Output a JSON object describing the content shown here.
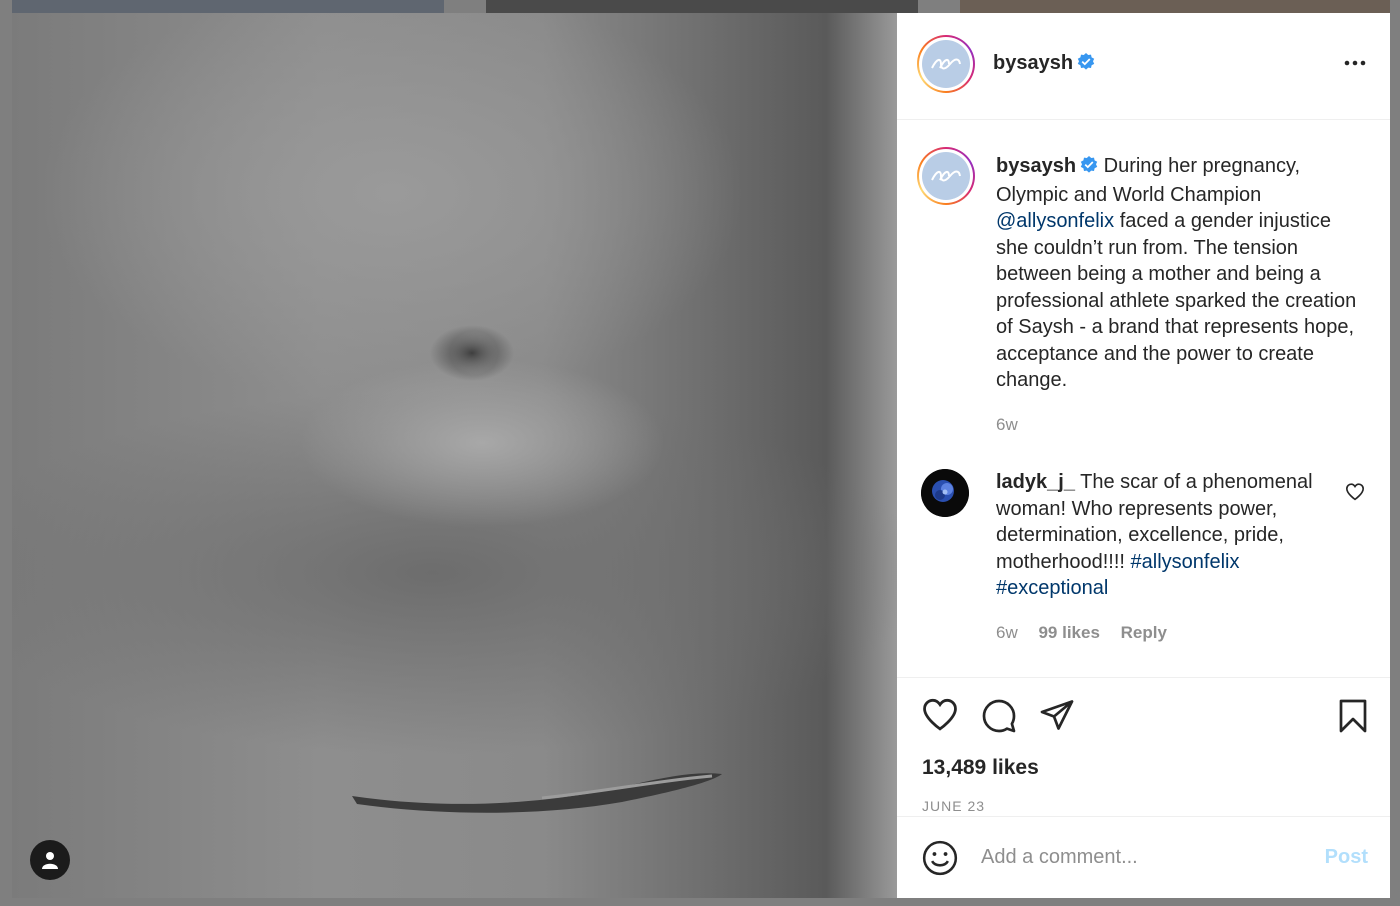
{
  "post": {
    "username": "bysaysh",
    "verified": true,
    "caption_text": "During her pregnancy, Olympic and World Champion",
    "caption_mention": "@allysonfelix",
    "caption_rest": "faced a gender injustice she couldn’t run from. The tension between being a mother and being a professional athlete sparked the creation of Saysh - a brand that represents hope, acceptance and the power to create change.",
    "caption_age": "6w",
    "likes": "13,489 likes",
    "date": "JUNE 23"
  },
  "comment": {
    "username": "ladyk_j_",
    "text": "The scar of a phenomenal woman! Who represents power, determination, excellence, pride, motherhood!!!!",
    "hashtag_1": "#allysonfelix",
    "hashtag_2": "#exceptional",
    "age": "6w",
    "likes": "99 likes",
    "reply": "Reply"
  },
  "add_comment": {
    "placeholder": "Add a comment...",
    "post_label": "Post"
  },
  "icons": [
    "more-icon",
    "verified-icon",
    "heart-icon",
    "comment-icon",
    "share-icon",
    "bookmark-icon",
    "emoji-icon",
    "user-tag-icon"
  ],
  "colors": {
    "link": "#00376b",
    "verified": "#3897f0",
    "post_disabled": "#b2dffc",
    "muted": "#8e8e8e"
  }
}
